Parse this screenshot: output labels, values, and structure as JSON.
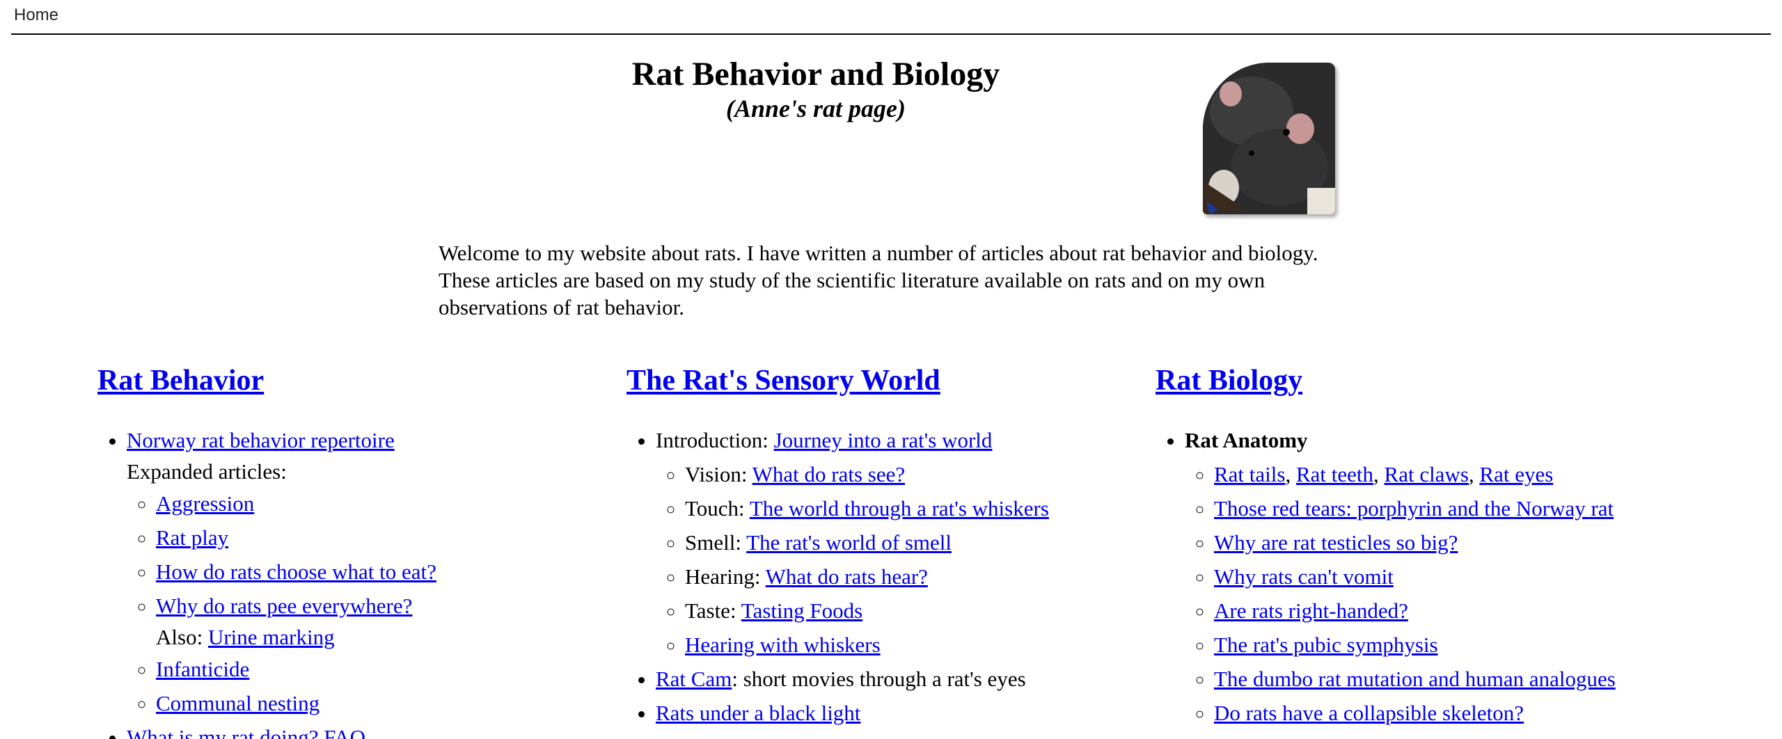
{
  "nav": {
    "home": "Home"
  },
  "header": {
    "title": "Rat Behavior and Biology",
    "subtitle": "(Anne's rat page)"
  },
  "intro": "Welcome to my website about rats.  I have written a number of articles about rat behavior and biology. These articles are based on my study of the scientific literature available on rats and on my own observations of rat behavior.",
  "behavior": {
    "heading": "Rat Behavior",
    "repertoire": "Norway rat behavior repertoire",
    "expanded_label": "Expanded articles:",
    "aggression": "Aggression",
    "play": "Rat play",
    "eat": "How do rats choose what to eat?",
    "pee": "Why do rats pee everywhere?",
    "also_label": "Also:",
    "urine": "Urine marking",
    "infanticide": "Infanticide",
    "nesting": "Communal nesting",
    "faq": "What is my rat doing? FAQ"
  },
  "sensory": {
    "heading": "The Rat's Sensory World",
    "intro_label": "Introduction:",
    "intro_link": "Journey into a rat's world",
    "vision_label": "Vision:",
    "vision_link": "What do rats see?",
    "touch_label": "Touch:",
    "touch_link": "The world through a rat's whiskers",
    "smell_label": "Smell:",
    "smell_link": "The rat's world of smell",
    "hearing_label": "Hearing:",
    "hearing_link": "What do rats hear?",
    "taste_label": "Taste:",
    "taste_link": "Tasting Foods",
    "whiskers_hearing": "Hearing with whiskers",
    "ratcam": "Rat Cam",
    "ratcam_desc": ": short movies through a rat's eyes",
    "blacklight": "Rats under a black light"
  },
  "biology": {
    "heading": "Rat Biology",
    "anatomy": "Rat Anatomy",
    "tails": "Rat tails",
    "teeth": "Rat teeth",
    "claws": "Rat claws",
    "eyes": "Rat eyes",
    "sep": ",",
    "tears": "Those red tears: porphyrin and the Norway rat",
    "testicles": "Why are rat testicles so big?",
    "vomit": "Why rats can't vomit",
    "handed": "Are rats right-handed?",
    "symphysis": "The rat's pubic symphysis",
    "dumbo": "The dumbo rat mutation and human analogues",
    "skeleton": "Do rats have a collapsible skeleton?"
  }
}
